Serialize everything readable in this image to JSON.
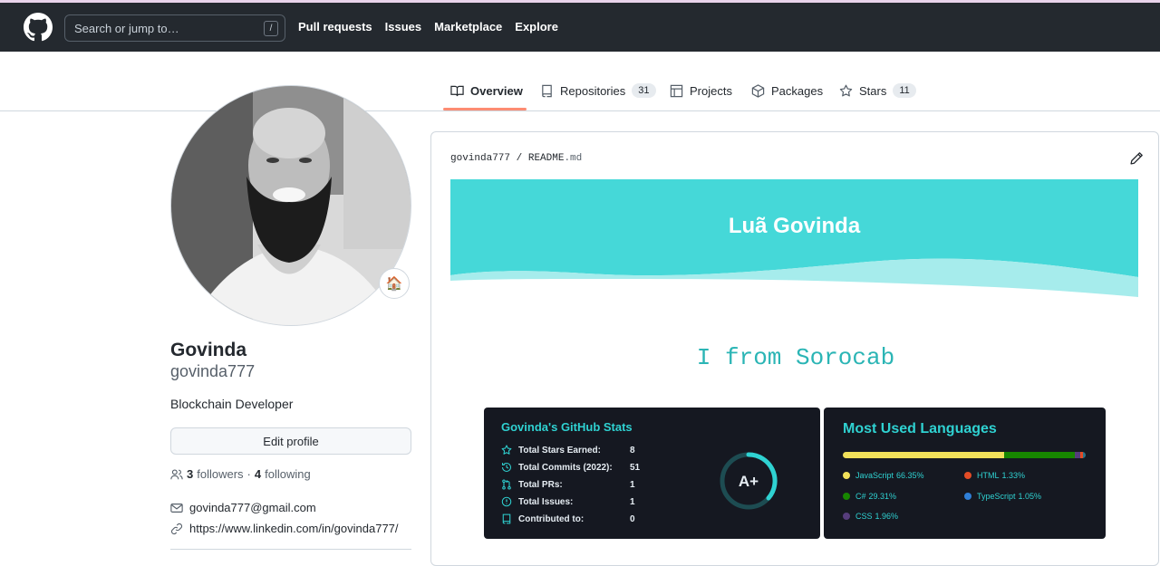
{
  "header": {
    "logo_icon": "github-mark-icon",
    "search_placeholder": "Search or jump to…",
    "search_key": "/",
    "nav": [
      "Pull requests",
      "Issues",
      "Marketplace",
      "Explore"
    ]
  },
  "tabs": [
    {
      "label": "Overview",
      "icon": "book-icon",
      "count": ""
    },
    {
      "label": "Repositories",
      "icon": "repo-icon",
      "count": "31"
    },
    {
      "label": "Projects",
      "icon": "table-icon",
      "count": ""
    },
    {
      "label": "Packages",
      "icon": "package-icon",
      "count": ""
    },
    {
      "label": "Stars",
      "icon": "star-icon",
      "count": "11"
    }
  ],
  "profile": {
    "status_emoji": "🏠",
    "name": "Govinda",
    "login": "govinda777",
    "bio": "Blockchain Developer",
    "edit_label": "Edit profile",
    "followers_count": "3",
    "followers_label": "followers",
    "separator": "·",
    "following_count": "4",
    "following_label": "following",
    "email": "govinda777@gmail.com",
    "link": "https://www.linkedin.com/in/govinda777/"
  },
  "readme": {
    "repo": "govinda777",
    "sep": "/",
    "file": "README",
    "ext": ".md",
    "banner_title": "Luã Govinda",
    "typing_text": "I from Sorocab",
    "banner_color": "#45d8d8"
  },
  "stats": {
    "title": "Govinda's GitHub Stats",
    "rows": [
      {
        "icon": "star-icon",
        "label": "Total Stars Earned:",
        "value": "8"
      },
      {
        "icon": "history-icon",
        "label": "Total Commits (2022):",
        "value": "51"
      },
      {
        "icon": "pull-request-icon",
        "label": "Total PRs:",
        "value": "1"
      },
      {
        "icon": "issue-icon",
        "label": "Total Issues:",
        "value": "1"
      },
      {
        "icon": "repo-icon",
        "label": "Contributed to:",
        "value": "0"
      }
    ],
    "grade": "A+"
  },
  "languages": {
    "title": "Most Used Languages",
    "items": [
      {
        "name": "JavaScript",
        "percent": "66.35%",
        "value": 66.35,
        "color": "#f1e05a"
      },
      {
        "name": "C#",
        "percent": "29.31%",
        "value": 29.31,
        "color": "#178600"
      },
      {
        "name": "CSS",
        "percent": "1.96%",
        "value": 1.96,
        "color": "#563d7c"
      },
      {
        "name": "HTML",
        "percent": "1.33%",
        "value": 1.33,
        "color": "#e34c26"
      },
      {
        "name": "TypeScript",
        "percent": "1.05%",
        "value": 1.05,
        "color": "#2b7489"
      }
    ]
  }
}
